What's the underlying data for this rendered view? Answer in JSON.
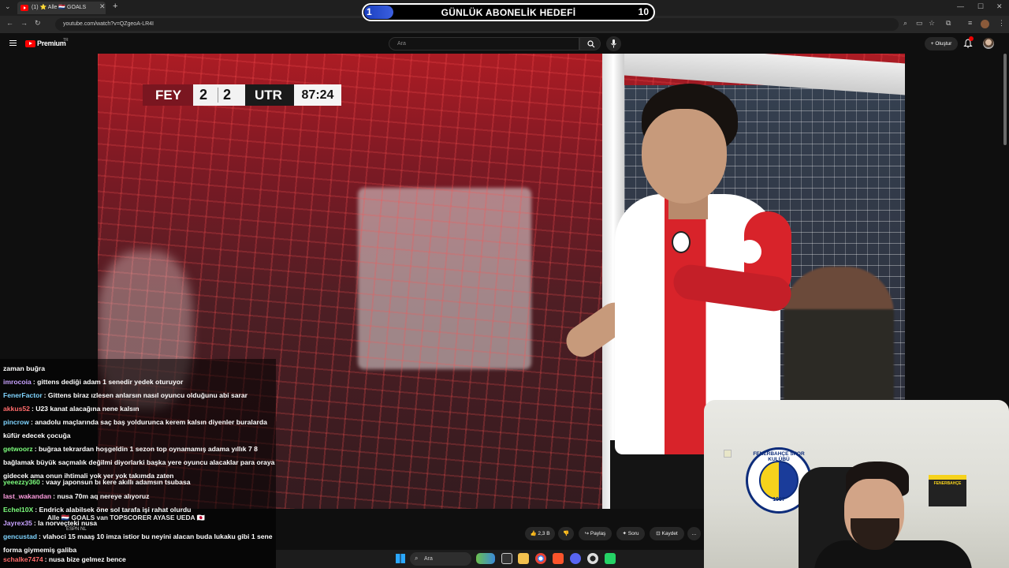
{
  "browser": {
    "tab_title": "(1) ⭐ Alle 🇳🇱 GOALS",
    "url": "youtube.com/watch?v=QZgeoA-LR4I",
    "new_tab": "+"
  },
  "goal_overlay": {
    "current": "1",
    "title": "GÜNLÜK ABONELİK HEDEFİ",
    "target": "10",
    "progress": 0.1
  },
  "youtube": {
    "brand": "Premium",
    "brand_suffix": "TR",
    "search_placeholder": "Ara",
    "create_label": "Oluştur",
    "notification_count": "9+"
  },
  "scoreboard": {
    "home": "FEY",
    "home_score": "2",
    "away_score": "2",
    "away": "UTR",
    "time": "87:24"
  },
  "actions": {
    "likes": "2,3 B",
    "share": "Paylaş",
    "ask": "Soru",
    "save": "Kaydet",
    "more": "…"
  },
  "chat": [
    {
      "user": "",
      "text": "zaman buğra",
      "color": "#ffffff"
    },
    {
      "user": "imrocoia",
      "text": "gittens dediği adam 1 senedir yedek oturuyor",
      "color": "#c8a2ff"
    },
    {
      "user": "FenerFactor",
      "text": "Gittens biraz ızlesen anlarsın nasıl oyuncu olduğunu abi sarar",
      "color": "#7fd4ff"
    },
    {
      "user": "akkus52",
      "text": "U23 kanat alacağına nene kalsın",
      "color": "#ff6b6b"
    },
    {
      "user": "pincrow",
      "text": "anadolu maçlarında saç baş yoldurunca kerem kalsın diyenler buralarda küfür edecek çocuğa",
      "color": "#7fd4ff"
    },
    {
      "user": "getwoorz",
      "text": "buğraa tekrardan hoşgeldin 1 sezon top oynamamış adama yıllık 7 8 bağlamak büyük saçmalık değilmi diyorlarki başka yere oyuncu alacaklar para oraya gidecek ama onun ihtimali yok yer yok takımda zaten",
      "color": "#7dff7d"
    },
    {
      "user": "yeeezzy360",
      "text": "vaay japonsun bı kere akıllı adamsın tsubasa",
      "color": "#7dff7d"
    },
    {
      "user": "last_wakandan",
      "text": "nusa 70m aq nereye alıyoruz",
      "color": "#ff9de0"
    },
    {
      "user": "Echel10X",
      "text": "Endrick alabilsek öne sol tarafa işi rahat olurdu",
      "color": "#7dff7d"
    },
    {
      "user": "Jayrex35",
      "text": "la norveçteki nusa",
      "color": "#c8a2ff"
    },
    {
      "user": "gencustad",
      "text": "vlahoci 15 maaş 10 imza istior bu neyini alacan buda lukaku gibi 1 sene forma giymemiş galiba",
      "color": "#7fd4ff"
    },
    {
      "user": "schalke7474",
      "text": "nusa bize gelmez bence",
      "color": "#ff6b6b"
    }
  ],
  "ticker": {
    "text": "Alle 🇳🇱 GOALS van TOPSCORER AYASE UEDA 🇯🇵",
    "channel": "ESPN NL"
  },
  "webcam": {
    "crest_text": "FENERBAHÇE SPOR KULÜBÜ",
    "crest_year": "1907",
    "sign_text": "FENERBAHÇE"
  },
  "taskbar": {
    "search_placeholder": "Ara"
  }
}
